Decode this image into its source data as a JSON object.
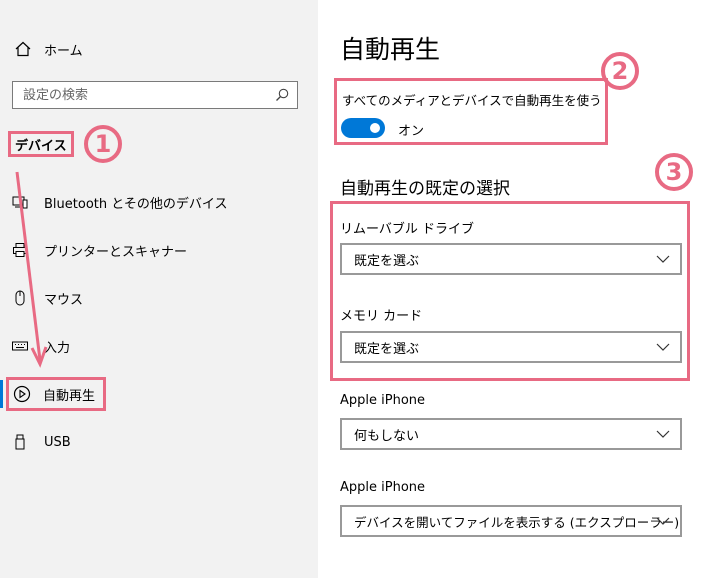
{
  "sidebar": {
    "home_label": "ホーム",
    "search_placeholder": "設定の検索",
    "category": "デバイス",
    "items": [
      {
        "label": "Bluetooth とその他のデバイス",
        "icon": "bluetooth-devices-icon"
      },
      {
        "label": "プリンターとスキャナー",
        "icon": "printer-icon"
      },
      {
        "label": "マウス",
        "icon": "mouse-icon"
      },
      {
        "label": "入力",
        "icon": "keyboard-icon"
      },
      {
        "label": "自動再生",
        "icon": "autoplay-icon",
        "active": true
      },
      {
        "label": "USB",
        "icon": "usb-icon"
      }
    ]
  },
  "annotations": {
    "step1": "1",
    "step2": "2",
    "step3": "3",
    "color": "#e86a83"
  },
  "main": {
    "title": "自動再生",
    "autoplay_toggle": {
      "label": "すべてのメディアとデバイスで自動再生を使う",
      "state": "オン",
      "on": true
    },
    "defaults_heading": "自動再生の既定の選択",
    "defaults": [
      {
        "label": "リムーバブル ドライブ",
        "value": "既定を選ぶ"
      },
      {
        "label": "メモリ カード",
        "value": "既定を選ぶ"
      },
      {
        "label": "Apple iPhone",
        "value": "何もしない"
      },
      {
        "label": "Apple iPhone",
        "value": "デバイスを開いてファイルを表示する (エクスプローラー)"
      }
    ]
  },
  "colors": {
    "accent": "#0078d7",
    "sidebar_bg": "#f2f2f2"
  }
}
